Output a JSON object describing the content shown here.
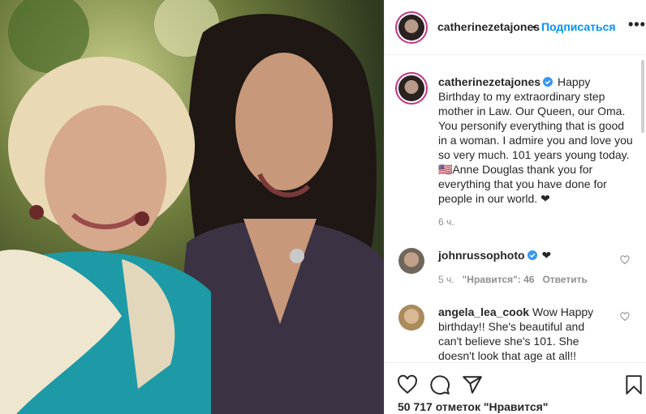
{
  "post": {
    "username": "catherinezetajones",
    "follow_label": "Подписаться",
    "separator": "•",
    "more_label": "•••"
  },
  "caption": {
    "username": "catherinezetajones",
    "text": "Happy Birthday to my extraordinary step mother in Law. Our Queen, our Oma. You personify everything that is good in a woman. I admire you and love you so very much. 101 years young today. 🇺🇸Anne Douglas thank you for everything that you have done for people in our world. ❤",
    "time": "6 ч."
  },
  "comments": [
    {
      "username": "johnrussophoto",
      "verified": true,
      "text": "❤",
      "time": "5 ч.",
      "likes": "\"Нравится\": 46",
      "reply": "Ответить"
    },
    {
      "username": "angela_lea_cook",
      "verified": false,
      "text": "Wow Happy birthday!! She's beautiful and can't believe she's 101. She doesn't look that age at all!!"
    }
  ],
  "footer": {
    "likes_text": "50 717 отметок \"Нравится\""
  },
  "icons": {
    "heart": "heart-icon",
    "comment": "comment-icon",
    "share": "share-icon",
    "save": "bookmark-icon",
    "verified": "verified-badge-icon"
  },
  "colors": {
    "link": "#0095f6",
    "verified": "#3897f0",
    "muted": "#8e8e8e",
    "story_ring": "#c13584"
  }
}
